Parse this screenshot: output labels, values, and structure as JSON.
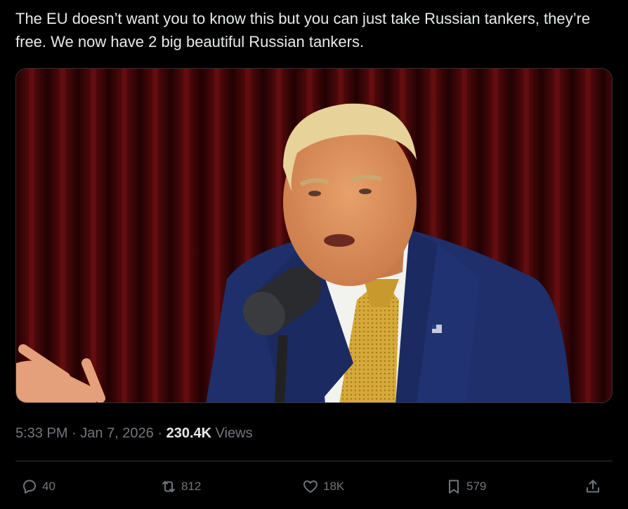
{
  "tweet": {
    "text": "The EU doesn’t want you to know this but you can just take Russian tankers, they’re free. We now have 2 big beautiful Russian tankers."
  },
  "meta": {
    "time": "5:33 PM",
    "sep1": " · ",
    "date": "Jan 7, 2026",
    "sep2": " · ",
    "views_count": "230.4K",
    "views_label": " Views"
  },
  "actions": {
    "replies": "40",
    "reposts": "812",
    "likes": "18K",
    "bookmarks": "579"
  },
  "icons": {
    "reply": "reply-icon",
    "repost": "repost-icon",
    "like": "heart-icon",
    "bookmark": "bookmark-icon",
    "share": "share-icon"
  },
  "colors": {
    "background": "#000000",
    "text": "#e7e9ea",
    "secondary": "#71767b",
    "border": "#2f3336"
  }
}
